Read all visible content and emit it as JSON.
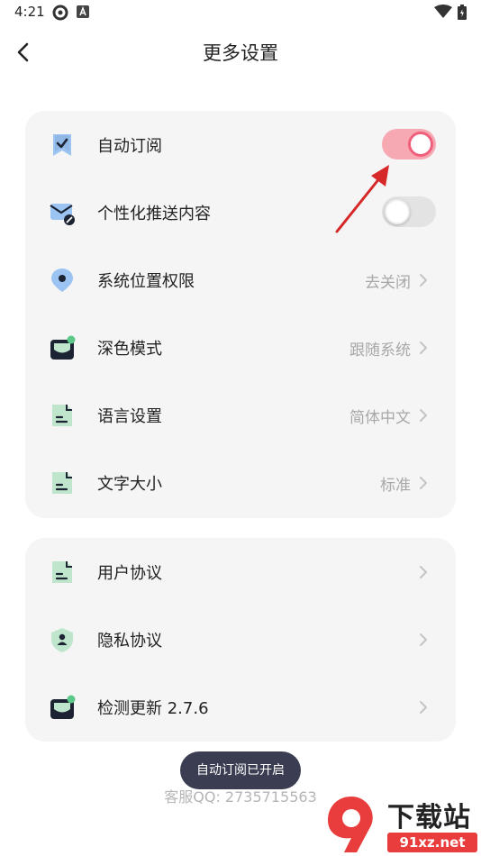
{
  "status_bar": {
    "time": "4:21"
  },
  "header": {
    "title": "更多设置"
  },
  "settings_group_1": [
    {
      "label": "自动订阅",
      "control": "toggle",
      "state": "on",
      "icon": "bookmark-check-icon"
    },
    {
      "label": "个性化推送内容",
      "control": "toggle",
      "state": "off",
      "icon": "mail-block-icon"
    },
    {
      "label": "系统位置权限",
      "value": "去关闭",
      "icon": "location-pin-icon"
    },
    {
      "label": "深色模式",
      "value": "跟随系统",
      "icon": "dark-mode-tray-icon"
    },
    {
      "label": "语言设置",
      "value": "简体中文",
      "icon": "document-icon"
    },
    {
      "label": "文字大小",
      "value": "标准",
      "icon": "document-icon"
    }
  ],
  "settings_group_2": [
    {
      "label": "用户协议",
      "value": "",
      "icon": "document-icon"
    },
    {
      "label": "隐私协议",
      "value": "",
      "icon": "shield-user-icon"
    },
    {
      "label": "检测更新 2.7.6",
      "value": "",
      "icon": "update-tray-icon"
    }
  ],
  "toast": {
    "text": "自动订阅已开启"
  },
  "footer": {
    "customer_service": "客服QQ: 2735715563"
  },
  "watermark": {
    "text_main": "下载站",
    "text_url": "91xz.net"
  },
  "colors": {
    "accent": "#f0607d",
    "toggle_on_track": "#f7a9b3",
    "icon_blue": "#9cc4f2",
    "icon_green": "#bfe6cd",
    "card_bg": "#f5f5f5",
    "toast_bg": "#3b3e52"
  }
}
